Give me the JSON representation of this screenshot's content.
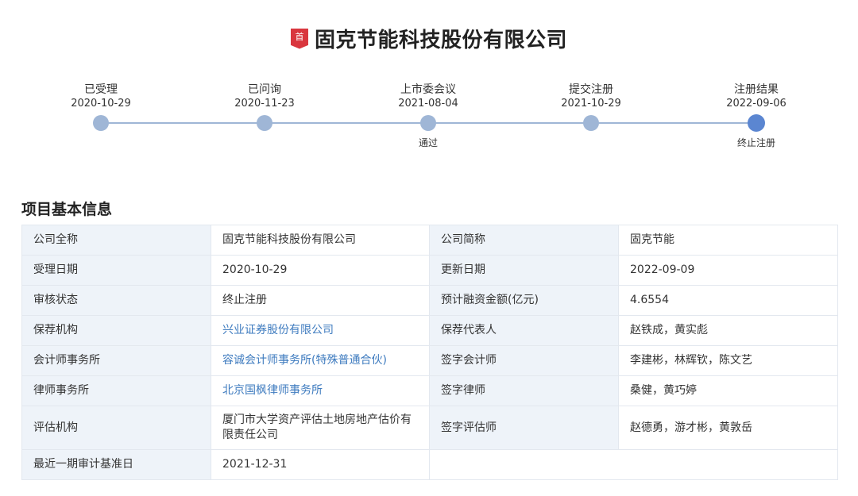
{
  "header": {
    "badge_text": "首",
    "company_name": "固克节能科技股份有限公司"
  },
  "timeline": {
    "steps": [
      {
        "label": "已受理",
        "date": "2020-10-29",
        "sub": ""
      },
      {
        "label": "已问询",
        "date": "2020-11-23",
        "sub": ""
      },
      {
        "label": "上市委会议",
        "date": "2021-08-04",
        "sub": "通过"
      },
      {
        "label": "提交注册",
        "date": "2021-10-29",
        "sub": ""
      },
      {
        "label": "注册结果",
        "date": "2022-09-06",
        "sub": "终止注册"
      }
    ],
    "current_index": 4
  },
  "section": {
    "title": "项目基本信息"
  },
  "info_table": {
    "rows": [
      {
        "label1": "公司全称",
        "value1": "固克节能科技股份有限公司",
        "label2": "公司简称",
        "value2": "固克节能"
      },
      {
        "label1": "受理日期",
        "value1": "2020-10-29",
        "label2": "更新日期",
        "value2": "2022-09-09"
      },
      {
        "label1": "审核状态",
        "value1": "终止注册",
        "label2": "预计融资金额(亿元)",
        "value2": "4.6554"
      },
      {
        "label1": "保荐机构",
        "value1": "兴业证券股份有限公司",
        "label2": "保荐代表人",
        "value2": "赵铁成，黄实彪"
      },
      {
        "label1": "会计师事务所",
        "value1": "容诚会计师事务所(特殊普通合伙)",
        "label2": "签字会计师",
        "value2": "李建彬，林辉钦，陈文艺"
      },
      {
        "label1": "律师事务所",
        "value1": "北京国枫律师事务所",
        "label2": "签字律师",
        "value2": "桑健，黄巧婷"
      },
      {
        "label1": "评估机构",
        "value1": "厦门市大学资产评估土地房地产估价有限责任公司",
        "label2": "签字评估师",
        "value2": "赵德勇，游才彬，黄敦岳"
      },
      {
        "label1": "最近一期审计基准日",
        "value1": "2021-12-31",
        "label2": "",
        "value2": ""
      }
    ]
  },
  "colors": {
    "badge": "#d9363e",
    "timeline_line": "#9fb6d6",
    "timeline_active": "#5b86d1",
    "label_bg": "#eef3f9",
    "link": "#3e7bbf"
  }
}
